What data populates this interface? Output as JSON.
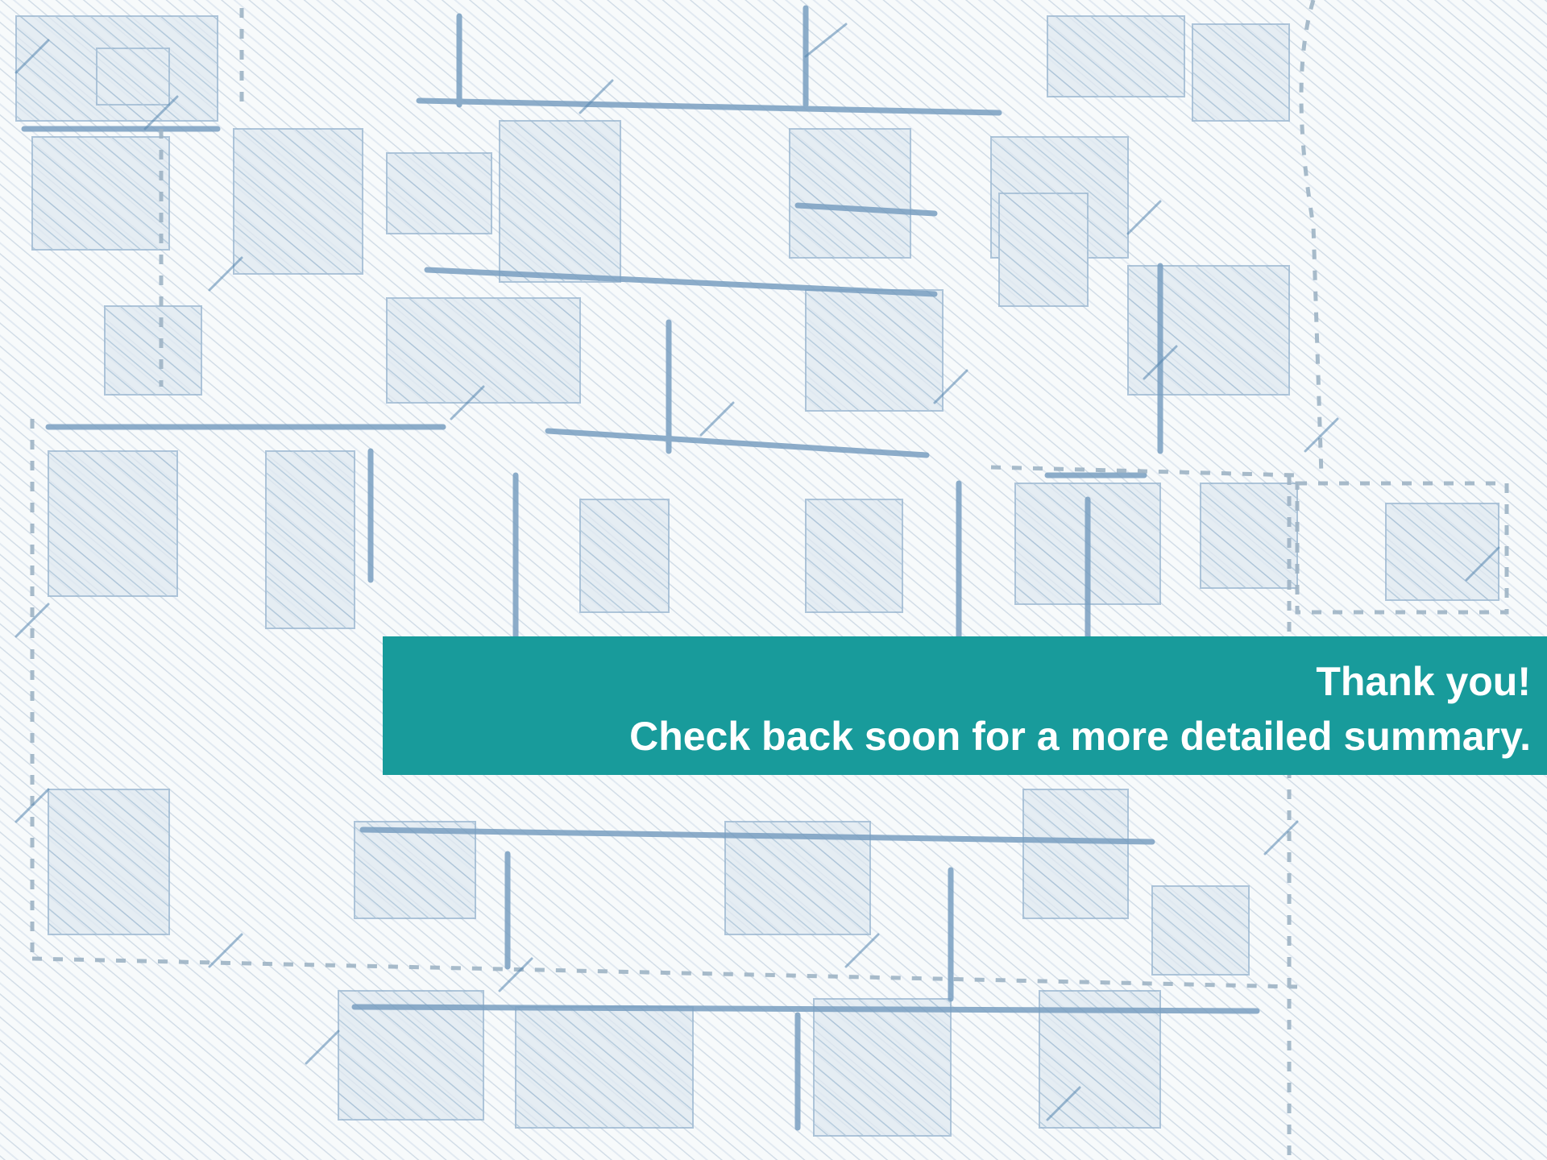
{
  "banner": {
    "line1": "Thank you!",
    "line2": "Check back soon for a more detailed summary.",
    "color": "#189b9b",
    "text_color": "#ffffff"
  },
  "background": {
    "style": "hand-sketched street map with blue hatching",
    "ink_color": "#3d78a8",
    "paper_color": "#f3f6f9"
  }
}
